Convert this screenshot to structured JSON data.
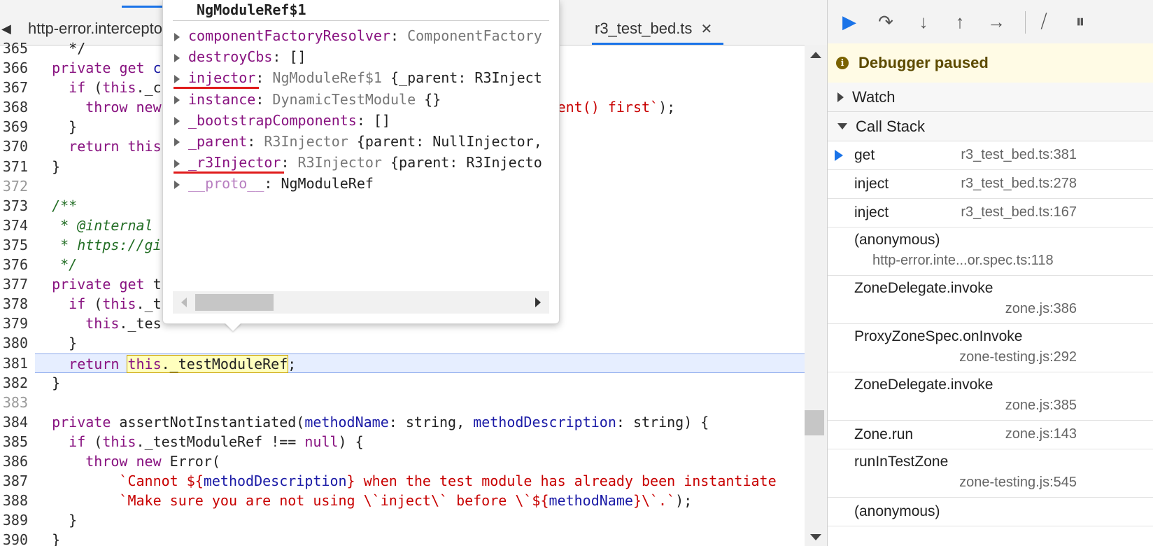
{
  "editor": {
    "tabs": [
      {
        "label": "http-error.intercepto"
      },
      {
        "label": "r3_test_bed.ts",
        "close": "✕"
      }
    ],
    "left_scroll_glyph": "◀"
  },
  "code_lines": [
    {
      "n": "365",
      "html": "    */"
    },
    {
      "n": "366",
      "html": "  <span class='kw'>private</span> <span class='kw'>get</span> <span class='pm'>c</span>"
    },
    {
      "n": "367",
      "html": "    <span class='kw'>if</span> (<span class='kw'>this</span>._c"
    },
    {
      "n": "368",
      "html": "      <span class='kw'>throw</span> <span class='kw'>new</span>                                               <span class='st'>ent() first`</span>);"
    },
    {
      "n": "369",
      "html": "    }"
    },
    {
      "n": "370",
      "html": "    <span class='kw'>return</span> <span class='kw'>this</span>"
    },
    {
      "n": "371",
      "html": "  }"
    },
    {
      "n": "372",
      "html": ""
    },
    {
      "n": "373",
      "html": "  <span class='cm'>/**</span>"
    },
    {
      "n": "374",
      "html": "  <span class='cm'> * @internal</span>"
    },
    {
      "n": "375",
      "html": "  <span class='cm'> * https://gi</span>"
    },
    {
      "n": "376",
      "html": "  <span class='cm'> */</span>"
    },
    {
      "n": "377",
      "html": "  <span class='kw'>private</span> <span class='kw'>get</span> t"
    },
    {
      "n": "378",
      "html": "    <span class='kw'>if</span> (<span class='kw'>this</span>._t"
    },
    {
      "n": "379",
      "html": "      <span class='kw'>this</span>._tes"
    },
    {
      "n": "380",
      "html": "    }"
    },
    {
      "n": "381",
      "html": "    <span class='kw'>return</span> <span class='hl'><span class='kw'>this</span>._testModuleRef</span>;",
      "current": true
    },
    {
      "n": "382",
      "html": "  }"
    },
    {
      "n": "383",
      "html": ""
    },
    {
      "n": "384",
      "html": "  <span class='kw'>private</span> assertNotInstantiated(<span class='pm'>methodName</span>: string, <span class='pm'>methodDescription</span>: string) {"
    },
    {
      "n": "385",
      "html": "    <span class='kw'>if</span> (<span class='kw'>this</span>._testModuleRef !== <span class='kw'>null</span>) {"
    },
    {
      "n": "386",
      "html": "      <span class='kw'>throw</span> <span class='kw'>new</span> Error("
    },
    {
      "n": "387",
      "html": "          <span class='st'>`Cannot ${</span><span class='pm'>methodDescription</span><span class='st'>} when the test module has already been instantiate</span>"
    },
    {
      "n": "388",
      "html": "          <span class='st'>`Make sure you are not using \\`inject\\` before \\`${</span><span class='pm'>methodName</span><span class='st'>}\\`.`</span>);"
    },
    {
      "n": "389",
      "html": "    }"
    },
    {
      "n": "390",
      "html": "  }"
    }
  ],
  "popover": {
    "title": "NgModuleRef$1",
    "props": [
      {
        "key": "componentFactoryResolver",
        "ctor": "ComponentFactory",
        "val": ""
      },
      {
        "key": "destroyCbs",
        "ctor": "",
        "val": "[]"
      },
      {
        "key": "injector",
        "ctor": "NgModuleRef$1",
        "val": "{_parent: R3Inject",
        "underlined": true
      },
      {
        "key": "instance",
        "ctor": "DynamicTestModule",
        "val": "{}"
      },
      {
        "key": "_bootstrapComponents",
        "ctor": "",
        "val": "[]"
      },
      {
        "key": "_parent",
        "ctor": "R3Injector",
        "val": "{parent: NullInjector,"
      },
      {
        "key": "_r3Injector",
        "ctor": "R3Injector",
        "val": "{parent: R3Injecto",
        "underlined": true
      },
      {
        "key": "__proto__",
        "ctor": "",
        "val": "NgModuleRef",
        "faded": true
      }
    ]
  },
  "debugger": {
    "toolbar": [
      {
        "icon": "resume-icon",
        "glyph": "▶"
      },
      {
        "icon": "step-over-icon",
        "glyph": "↷"
      },
      {
        "icon": "step-into-icon",
        "glyph": "↓"
      },
      {
        "icon": "step-out-icon",
        "glyph": "↑"
      },
      {
        "icon": "step-icon",
        "glyph": "→"
      },
      {
        "icon": "deactivate-breakpoints-icon",
        "glyph": "⧸"
      },
      {
        "icon": "pause-on-exceptions-icon",
        "glyph": "⏸"
      }
    ],
    "paused_text": "Debugger paused",
    "watch_label": "Watch",
    "callstack_label": "Call Stack",
    "frames": [
      {
        "fn": "get",
        "loc": "r3_test_bed.ts:381",
        "current": true,
        "layout": "single"
      },
      {
        "fn": "inject",
        "loc": "r3_test_bed.ts:278",
        "layout": "single"
      },
      {
        "fn": "inject",
        "loc": "r3_test_bed.ts:167",
        "layout": "single"
      },
      {
        "fn": "(anonymous)",
        "loc": "http-error.inte...or.spec.ts:118",
        "layout": "double-indent"
      },
      {
        "fn": "ZoneDelegate.invoke",
        "loc": "zone.js:386",
        "layout": "double"
      },
      {
        "fn": "ProxyZoneSpec.onInvoke",
        "loc": "zone-testing.js:292",
        "layout": "double"
      },
      {
        "fn": "ZoneDelegate.invoke",
        "loc": "zone.js:385",
        "layout": "double"
      },
      {
        "fn": "Zone.run",
        "loc": "zone.js:143",
        "layout": "single"
      },
      {
        "fn": "runInTestZone",
        "loc": "zone-testing.js:545",
        "layout": "double"
      },
      {
        "fn": "(anonymous)",
        "loc": "",
        "layout": "single"
      }
    ],
    "colors": {
      "accent": "#1a73e8",
      "paused_bg": "#fffbe5",
      "keyword": "#881280",
      "string": "#c80000",
      "comment": "#236e25"
    }
  }
}
